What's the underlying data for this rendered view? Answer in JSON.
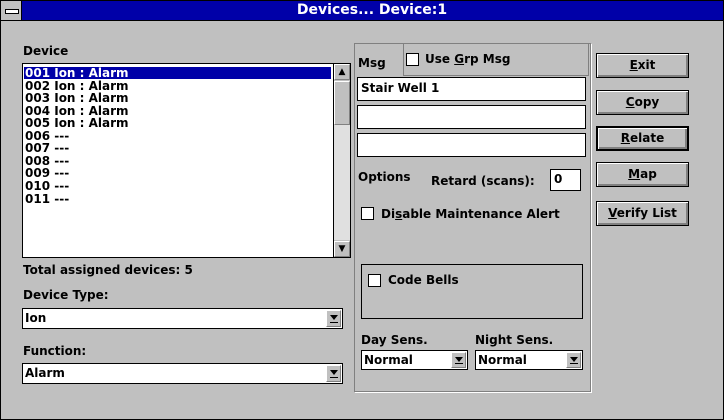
{
  "window": {
    "title": "Devices... Device:1"
  },
  "device_list": {
    "label": "Device",
    "items": [
      "001 Ion : Alarm",
      "002 Ion : Alarm",
      "003 Ion : Alarm",
      "004 Ion : Alarm",
      "005 Ion : Alarm",
      "006 ---",
      "007 ---",
      "008 ---",
      "009 ---",
      "010 ---",
      "011 ---"
    ],
    "selected_index": 0
  },
  "total_assigned": "Total assigned devices: 5",
  "device_type": {
    "label": "Device Type:",
    "value": "Ion"
  },
  "function": {
    "label": "Function:",
    "value": "Alarm"
  },
  "msg": {
    "label": "Msg",
    "use_grp_msg": {
      "pre": "Use ",
      "accel": "G",
      "post": "rp Msg",
      "checked": false
    },
    "lines": [
      "Stair Well 1",
      "",
      ""
    ]
  },
  "options": {
    "label": "Options",
    "retard_label": "Retard (scans):",
    "retard_value": "0",
    "disable_maint": {
      "pre": "Di",
      "accel": "s",
      "post": "able Maintenance Alert",
      "checked": false
    },
    "code_bells": {
      "label": "Code Bells",
      "checked": false
    }
  },
  "day_sens": {
    "label": "Day Sens.",
    "value": "Normal"
  },
  "night_sens": {
    "label": "Night Sens.",
    "value": "Normal"
  },
  "buttons": {
    "exit": {
      "accel": "E",
      "rest": "xit"
    },
    "copy": {
      "accel": "C",
      "rest": "opy"
    },
    "relate": {
      "accel": "R",
      "rest": "elate"
    },
    "map": {
      "accel": "M",
      "rest": "ap"
    },
    "verify": {
      "accel": "V",
      "rest": "erify List"
    }
  },
  "colors": {
    "titlebar": "#0000a8",
    "face": "#c0c0c0",
    "selection": "#0000a8"
  }
}
